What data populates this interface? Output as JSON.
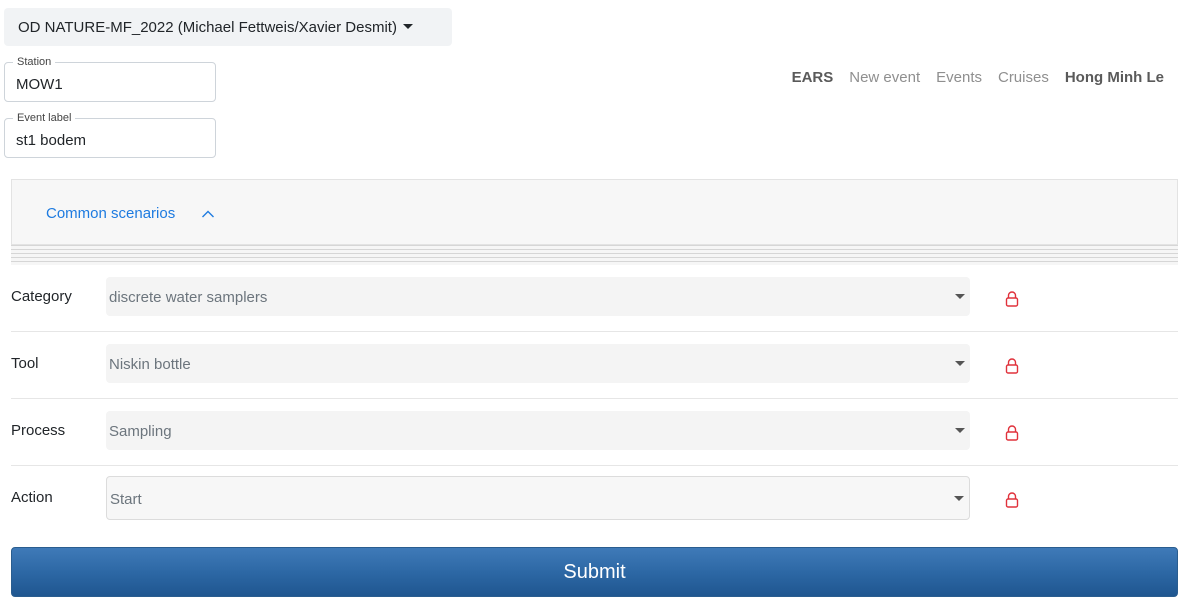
{
  "cruise_selector": {
    "label": "OD NATURE-MF_2022 (Michael Fettweis/Xavier Desmit)"
  },
  "station": {
    "legend": "Station",
    "value": "MOW1"
  },
  "event_label": {
    "legend": "Event label",
    "value": "st1 bodem"
  },
  "nav": {
    "brand": "EARS",
    "new_event": "New event",
    "events": "Events",
    "cruises": "Cruises",
    "user": "Hong Minh Le"
  },
  "scenarios": {
    "toggle_label": "Common scenarios",
    "icon": "chevron-up-icon",
    "accent": "#1e7be0"
  },
  "rows": [
    {
      "label": "Category",
      "value": "discrete water samplers",
      "icon": "lock-icon"
    },
    {
      "label": "Tool",
      "value": "Niskin bottle",
      "icon": "lock-icon"
    },
    {
      "label": "Process",
      "value": "Sampling",
      "icon": "lock-icon"
    },
    {
      "label": "Action",
      "value": "Start",
      "icon": "lock-icon"
    }
  ],
  "lock_color": "#e0323c",
  "submit": {
    "label": "Submit",
    "color": "#2d68a5"
  }
}
